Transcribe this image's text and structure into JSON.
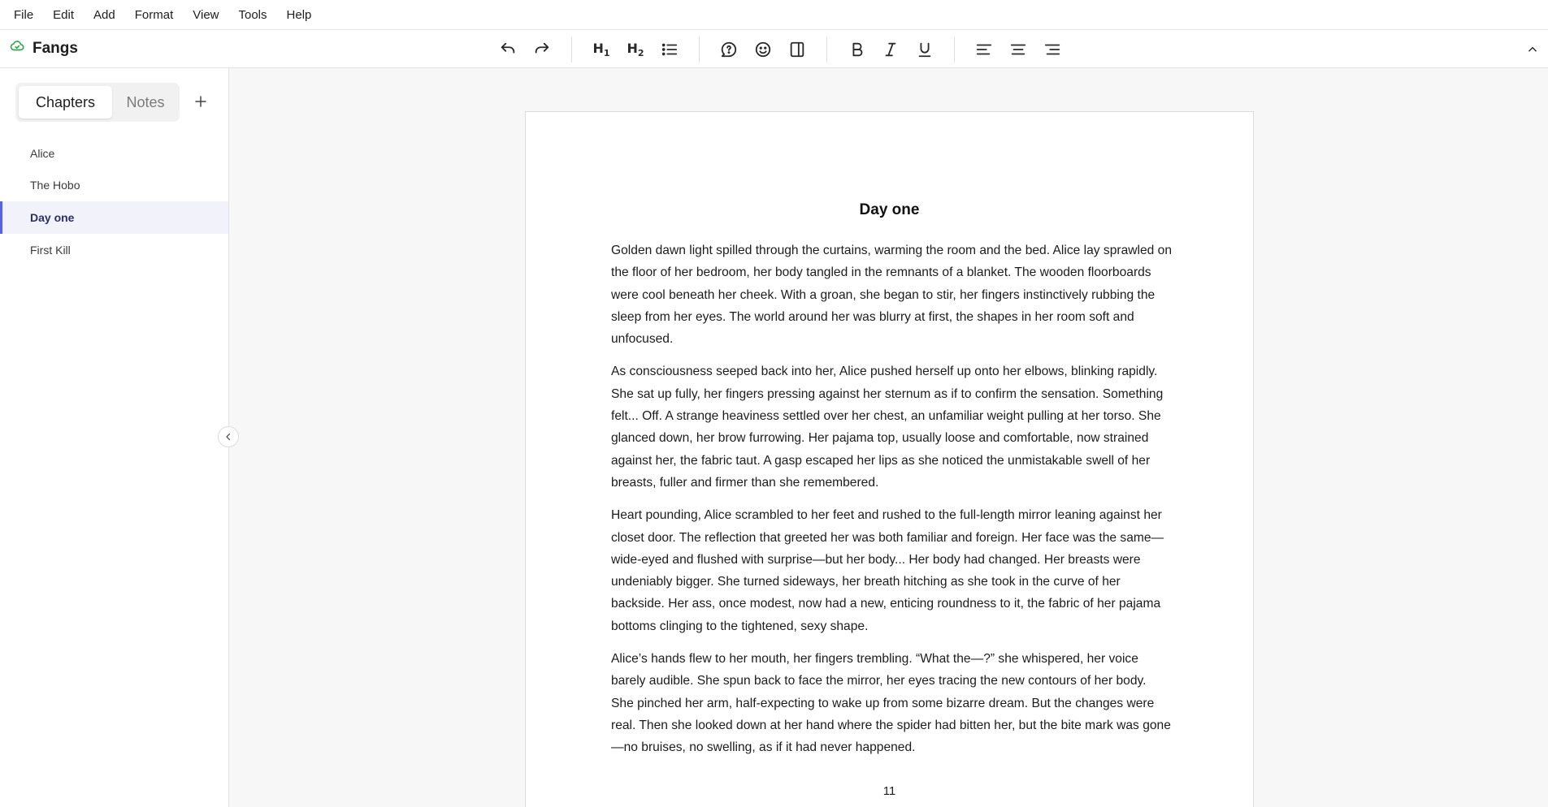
{
  "menu": {
    "items": [
      {
        "key": "file",
        "label": "File"
      },
      {
        "key": "edit",
        "label": "Edit"
      },
      {
        "key": "add",
        "label": "Add"
      },
      {
        "key": "format",
        "label": "Format"
      },
      {
        "key": "view",
        "label": "View"
      },
      {
        "key": "tools",
        "label": "Tools"
      },
      {
        "key": "help",
        "label": "Help"
      }
    ]
  },
  "toolbar": {
    "app_name": "Fangs",
    "brand_icon": "cloud-sync-icon",
    "brand_color": "#2fa84f",
    "h1_label": "H",
    "h1_sub": "1",
    "h2_label": "H",
    "h2_sub": "2",
    "icons": [
      "undo-icon",
      "redo-icon",
      "heading-1-icon",
      "heading-2-icon",
      "bullet-list-icon",
      "comment-icon",
      "emoji-icon",
      "split-view-icon",
      "bold-icon",
      "italic-icon",
      "underline-icon",
      "align-left-icon",
      "align-center-icon",
      "align-right-icon",
      "chevron-up-icon"
    ]
  },
  "sidebar": {
    "tabs": [
      {
        "label": "Chapters",
        "active": true
      },
      {
        "label": "Notes",
        "active": false
      }
    ],
    "add_icon": "plus-icon",
    "chapters": [
      {
        "label": "Alice",
        "selected": false
      },
      {
        "label": "The Hobo",
        "selected": false
      },
      {
        "label": "Day one",
        "selected": true
      },
      {
        "label": "First Kill",
        "selected": false
      }
    ],
    "accent_color": "#5a63d8"
  },
  "document": {
    "title": "Day one",
    "paragraphs": [
      "Golden dawn light spilled through the curtains, warming the room and the bed. Alice lay sprawled on the floor of her bedroom, her body tangled in the remnants of a blanket. The wooden floorboards were cool beneath her cheek. With a groan, she began to stir, her fingers instinctively rubbing the sleep from her eyes. The world around her was blurry at first, the shapes in her room soft and unfocused.",
      "As consciousness seeped back into her, Alice pushed herself up onto her elbows, blinking rapidly. She sat up fully, her fingers pressing against her sternum as if to confirm the sensation. Something felt... Off. A strange heaviness settled over her chest, an unfamiliar weight pulling at her torso. She glanced down, her brow furrowing. Her pajama top, usually loose and comfortable, now strained against her, the fabric taut. A gasp escaped her lips as she noticed the unmistakable swell of her breasts, fuller and firmer than she remembered.",
      "Heart pounding, Alice scrambled to her feet and rushed to the full-length mirror leaning against her closet door. The reflection that greeted her was both familiar and foreign. Her face was the same—wide-eyed and flushed with surprise—but her body... Her body had changed. Her breasts were undeniably bigger. She turned sideways, her breath hitching as she took in the curve of her backside. Her ass, once modest, now had a new, enticing roundness to it, the fabric of her pajama bottoms clinging to the tightened, sexy shape.",
      "Alice’s hands flew to her mouth, her fingers trembling. “What the—?” she whispered, her voice barely audible. She spun back to face the mirror, her eyes tracing the new contours of her body. She pinched her arm, half-expecting to wake up from some bizarre dream. But the changes were real. Then she looked down at her hand where the spider had bitten her, but the bite mark was gone—no bruises, no swelling, as if it had never happened."
    ],
    "page_number": "11"
  }
}
